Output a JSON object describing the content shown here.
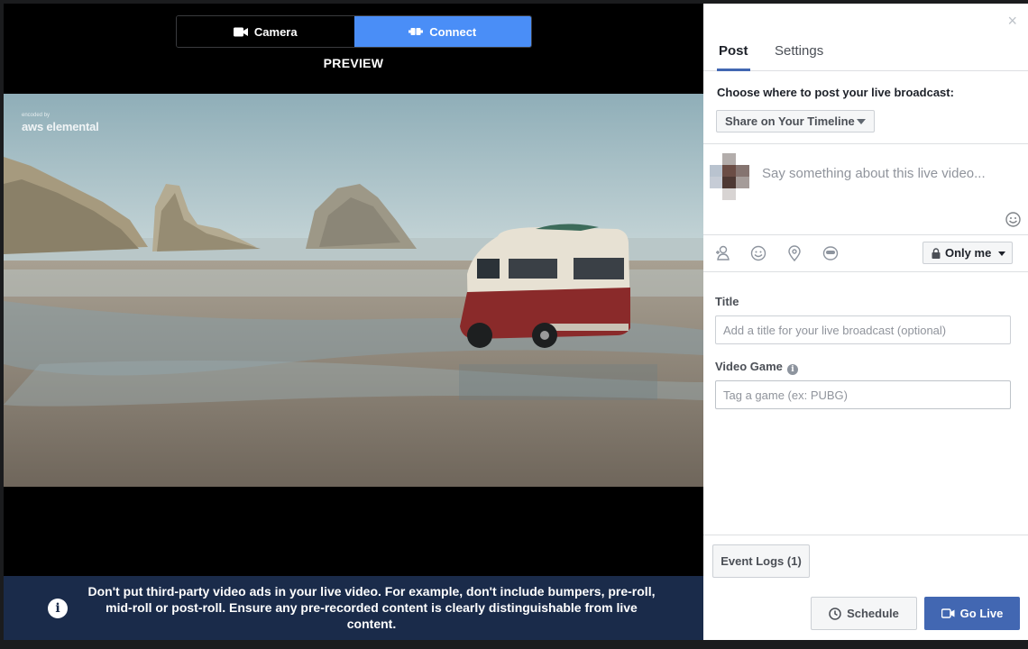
{
  "source_toggle": {
    "camera_label": "Camera",
    "connect_label": "Connect",
    "selected": "Connect"
  },
  "preview": {
    "label": "PREVIEW",
    "watermark_small": "encoded by",
    "watermark": "aws elemental"
  },
  "notice": {
    "text": "Don't put third-party video ads in your live video. For example, don't include bumpers, pre-roll, mid-roll or post-roll. Ensure any pre-recorded content is clearly distinguishable from live content."
  },
  "panel": {
    "close_glyph": "×",
    "tabs": [
      {
        "label": "Post",
        "active": true
      },
      {
        "label": "Settings",
        "active": false
      }
    ],
    "where_label": "Choose where to post your live broadcast:",
    "destination": "Share on Your Timeline",
    "compose_placeholder": "Say something about this live video...",
    "audience": "Only me",
    "title_label": "Title",
    "title_placeholder": "Add a title for your live broadcast (optional)",
    "game_label": "Video Game",
    "game_placeholder": "Tag a game (ex: PUBG)",
    "event_logs": "Event Logs (1)",
    "schedule": "Schedule",
    "go_live": "Go Live"
  },
  "colors": {
    "connect_blue": "#4a8ef7",
    "fb_blue": "#4267b2",
    "notice_bg": "#1a2b4a"
  },
  "icons": [
    "video-camera-icon",
    "connect-plug-icon",
    "info-icon",
    "close-icon",
    "smiley-icon",
    "tag-person-icon",
    "feeling-icon",
    "location-icon",
    "sticker-icon",
    "lock-icon",
    "clock-icon"
  ]
}
